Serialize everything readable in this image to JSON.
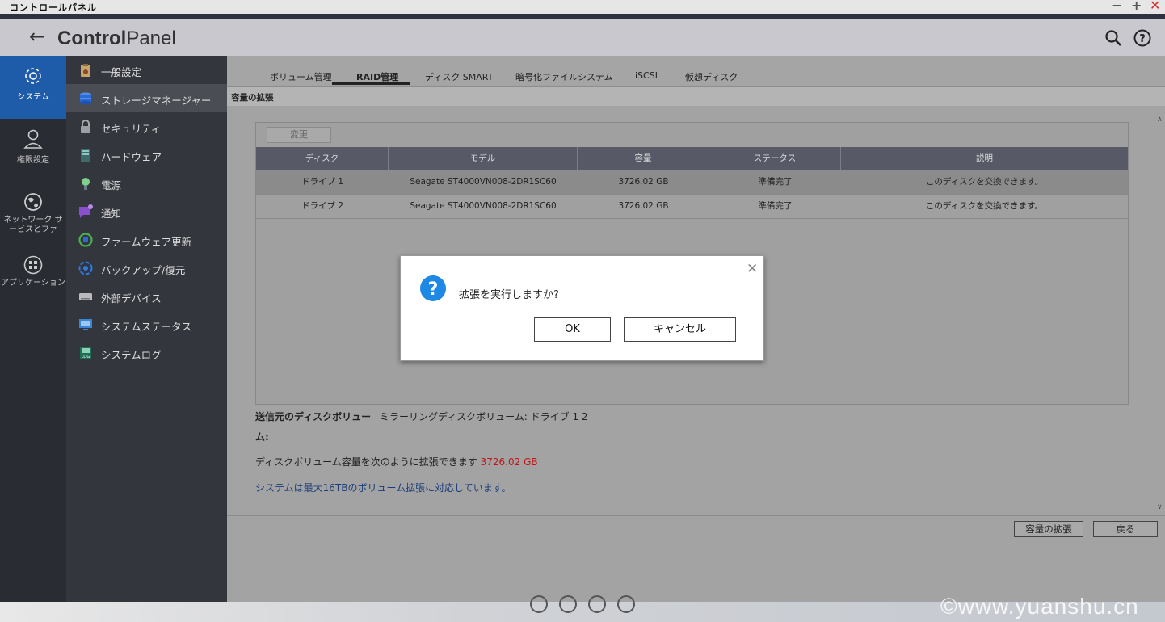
{
  "window": {
    "title": "コントロールパネル"
  },
  "header": {
    "title_bold": "Control",
    "title_light": "Panel"
  },
  "leftnav": [
    {
      "label": "システム",
      "icon": "gear-icon"
    },
    {
      "label": "権限設定",
      "icon": "user-icon"
    },
    {
      "label": "ネットワーク サービスとファ",
      "icon": "globe-icon"
    },
    {
      "label": "アプリケーション",
      "icon": "apps-grid-icon"
    }
  ],
  "submenu": [
    {
      "label": "一般設定",
      "icon": "general-settings-icon",
      "color": "#c9a46a"
    },
    {
      "label": "ストレージマネージャー",
      "icon": "storage-icon",
      "color": "#2c6bd6"
    },
    {
      "label": "セキュリティ",
      "icon": "lock-icon",
      "color": "#9aa0a6"
    },
    {
      "label": "ハードウェア",
      "icon": "hardware-icon",
      "color": "#5ca6a0"
    },
    {
      "label": "電源",
      "icon": "power-bulb-icon",
      "color": "#7fd08a"
    },
    {
      "label": "通知",
      "icon": "notification-icon",
      "color": "#8a4fcf"
    },
    {
      "label": "ファームウェア更新",
      "icon": "firmware-icon",
      "color": "#4caf50"
    },
    {
      "label": "バックアップ/復元",
      "icon": "backup-icon",
      "color": "#2c7be5"
    },
    {
      "label": "外部デバイス",
      "icon": "external-device-icon",
      "color": "#bbbbbb"
    },
    {
      "label": "システムステータス",
      "icon": "monitor-icon",
      "color": "#3a86d6"
    },
    {
      "label": "システムログ",
      "icon": "log-icon",
      "color": "#2a8a6a"
    }
  ],
  "tabs": [
    "ボリューム管理",
    "RAID管理",
    "ディスク SMART",
    "暗号化ファイルシステム",
    "iSCSI",
    "仮想ディスク"
  ],
  "section_title": "容量の拡張",
  "change_button": "変更",
  "table": {
    "columns": [
      "ディスク",
      "モデル",
      "容量",
      "ステータス",
      "説明"
    ],
    "rows": [
      [
        "ドライブ 1",
        "Seagate ST4000VN008-2DR1SC60",
        "3726.02 GB",
        "準備完了",
        "このディスクを交換できます。"
      ],
      [
        "ドライブ 2",
        "Seagate ST4000VN008-2DR1SC60",
        "3726.02 GB",
        "準備完了",
        "このディスクを交換できます。"
      ]
    ]
  },
  "info": {
    "source_label_1": "送信元のディスクボリュー",
    "source_label_2": "ム:",
    "source_value": "ミラーリングディスクボリューム: ドライブ 1 2",
    "expand_text": "ディスクボリューム容量を次のように拡張できます",
    "expand_value": "3726.02 GB",
    "max_note": "システムは最大16TBのボリューム拡張に対応しています。"
  },
  "buttons": {
    "expand": "容量の拡張",
    "back": "戻る"
  },
  "dialog": {
    "message": "拡張を実行しますか?",
    "ok": "OK",
    "cancel": "キャンセル"
  },
  "watermark": "©www.yuanshu.cn"
}
